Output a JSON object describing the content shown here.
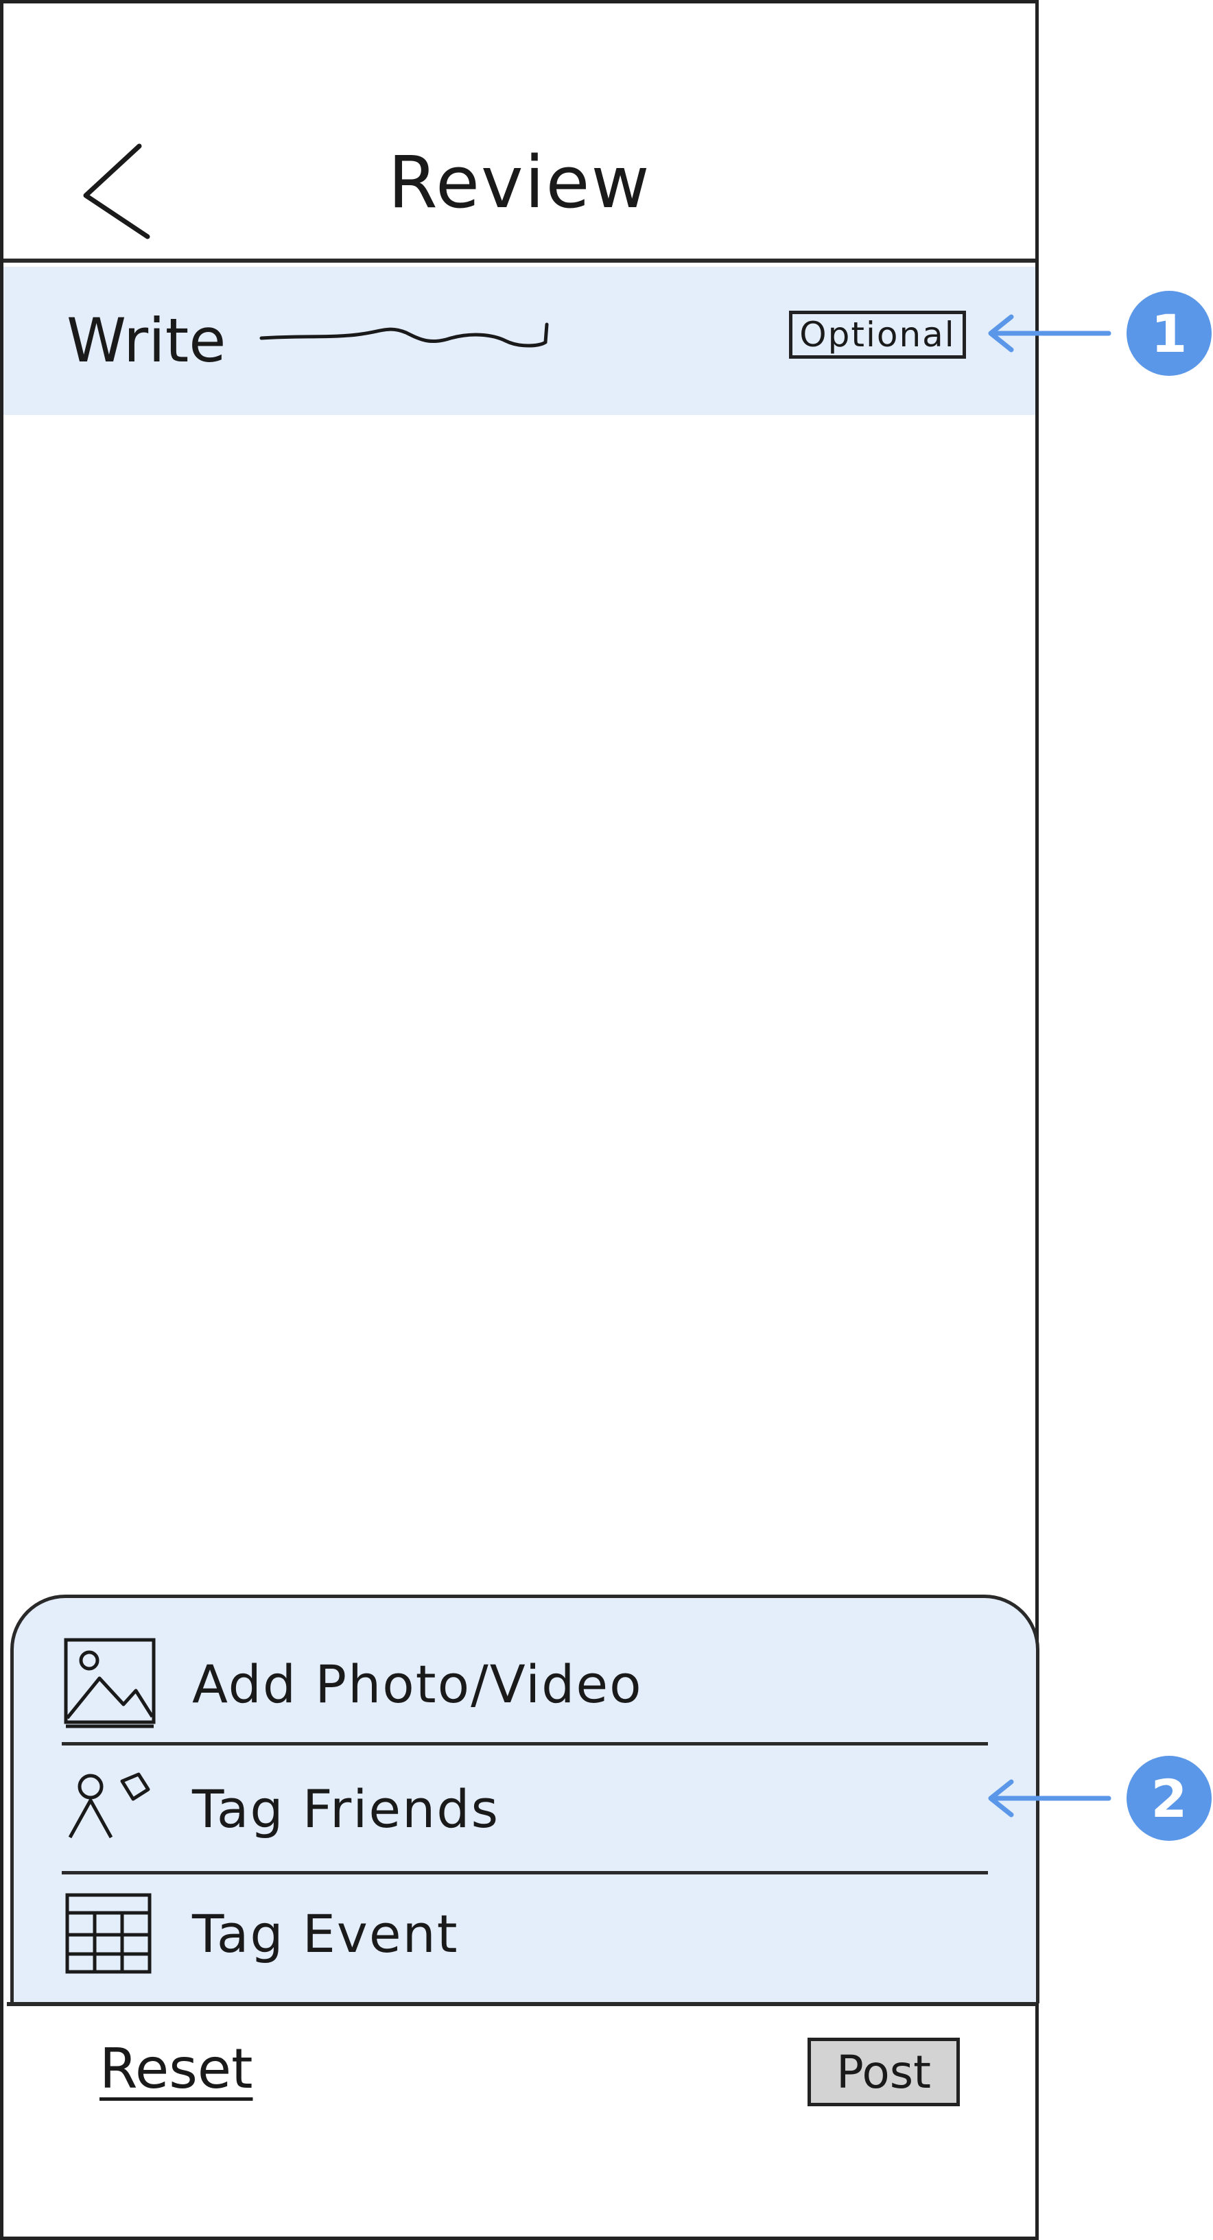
{
  "header": {
    "title": "Review",
    "back_icon": "chevron-left-icon"
  },
  "write": {
    "label": "Write",
    "badge": "Optional"
  },
  "options": [
    {
      "label": "Add Photo/Video",
      "icon": "image-icon"
    },
    {
      "label": "Tag Friends",
      "icon": "tag-person-icon"
    },
    {
      "label": "Tag Event",
      "icon": "calendar-icon"
    }
  ],
  "footer": {
    "reset_label": "Reset",
    "post_label": "Post"
  },
  "annotations": [
    {
      "number": "1"
    },
    {
      "number": "2"
    }
  ],
  "colors": {
    "highlight": "#e4eefb",
    "annotation": "#5b97e8",
    "post_button": "#d3d3d3"
  }
}
